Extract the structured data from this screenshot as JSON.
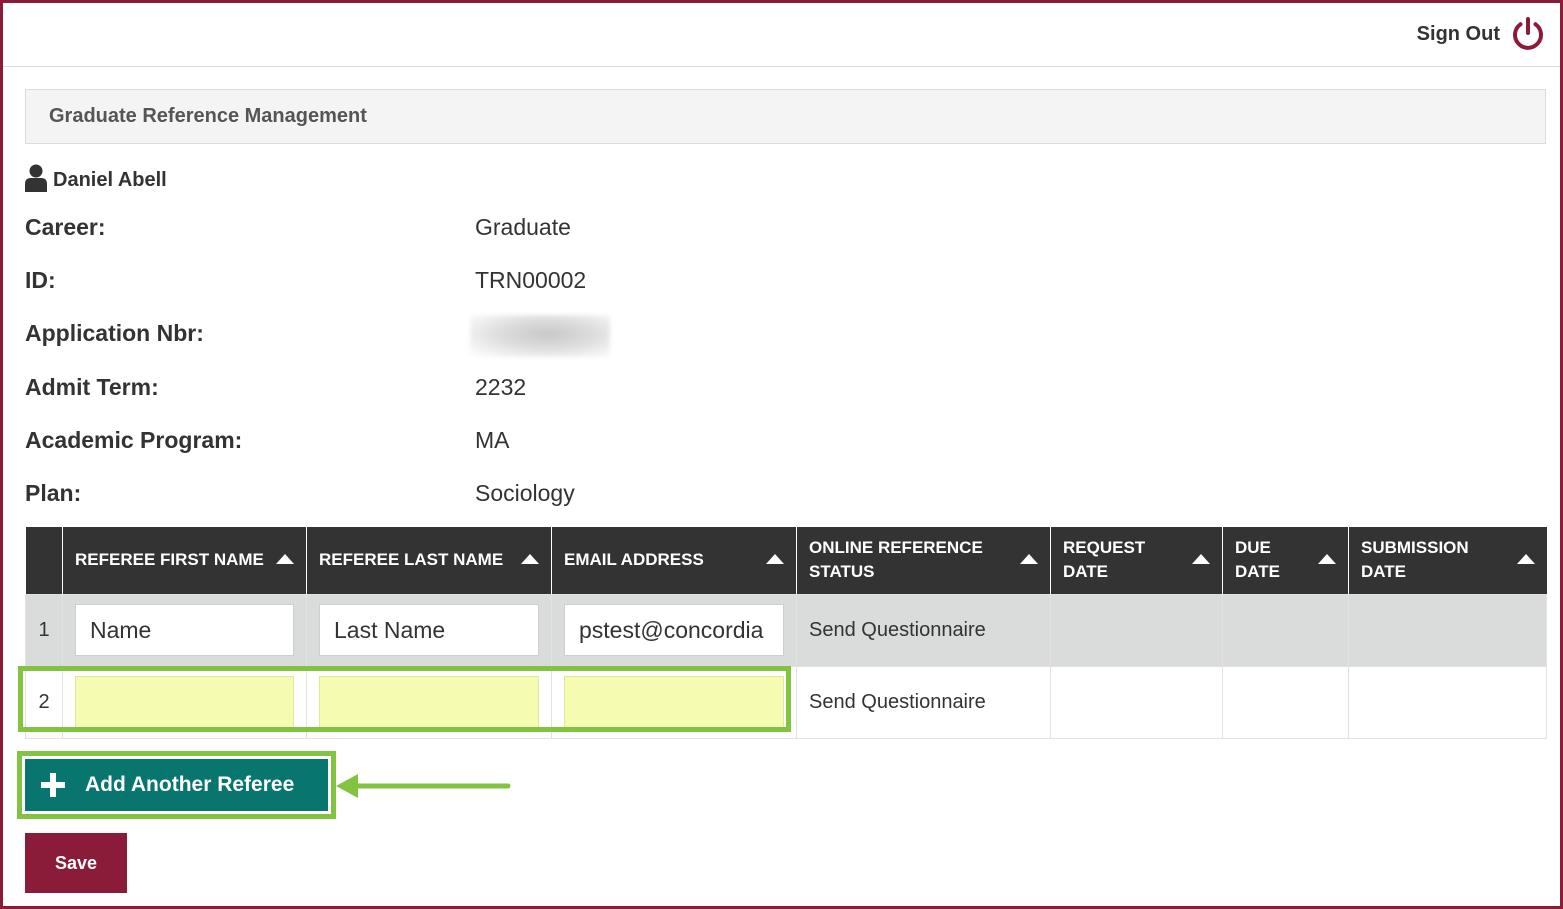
{
  "header": {
    "sign_out_label": "Sign Out"
  },
  "panel": {
    "title": "Graduate Reference Management"
  },
  "applicant": {
    "name": "Daniel Abell"
  },
  "fields": [
    {
      "label": "Career:",
      "value": "Graduate"
    },
    {
      "label": "ID:",
      "value": "TRN00002"
    },
    {
      "label": "Application Nbr:",
      "value": ""
    },
    {
      "label": "Admit Term:",
      "value": "2232"
    },
    {
      "label": "Academic Program:",
      "value": "MA"
    },
    {
      "label": "Plan:",
      "value": "Sociology"
    }
  ],
  "table": {
    "columns": [
      "",
      "REFEREE FIRST NAME",
      "REFEREE LAST NAME",
      "EMAIL ADDRESS",
      "ONLINE REFERENCE STATUS",
      "REQUEST DATE",
      "DUE DATE",
      "SUBMISSION DATE"
    ],
    "rows": [
      {
        "num": "1",
        "first_name": "Name",
        "last_name": "Last Name",
        "email": "pstest@concordia",
        "status": "Send Questionnaire",
        "request_date": "",
        "due_date": "",
        "submission_date": ""
      },
      {
        "num": "2",
        "first_name": "",
        "last_name": "",
        "email": "",
        "status": "Send Questionnaire",
        "request_date": "",
        "due_date": "",
        "submission_date": ""
      }
    ]
  },
  "actions": {
    "add_referee_label": "Add Another Referee",
    "save_label": "Save"
  },
  "colors": {
    "brand": "#8a1c3a",
    "add_button": "#08756f",
    "highlight": "#82c341",
    "header_bg": "#333333"
  }
}
